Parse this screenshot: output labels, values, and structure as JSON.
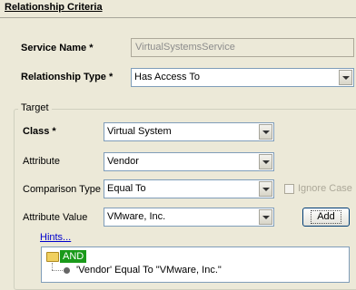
{
  "header": {
    "title": "Relationship Criteria"
  },
  "service_name": {
    "label": "Service Name *",
    "value": "VirtualSystemsService"
  },
  "relationship_type": {
    "label": "Relationship Type *",
    "value": "Has Access To"
  },
  "target": {
    "legend": "Target",
    "class": {
      "label": "Class *",
      "value": "Virtual System"
    },
    "attribute": {
      "label": "Attribute",
      "value": "Vendor"
    },
    "comparison_type": {
      "label": "Comparison Type",
      "value": "Equal To"
    },
    "ignore_case": {
      "label": "Ignore Case",
      "checked": false
    },
    "attribute_value": {
      "label": "Attribute Value",
      "value": "VMware, Inc."
    },
    "add_button": "Add",
    "hints_link": "Hints...",
    "tree": {
      "root": "AND",
      "children": [
        "'Vendor' Equal To \"VMware, Inc.\""
      ]
    }
  }
}
